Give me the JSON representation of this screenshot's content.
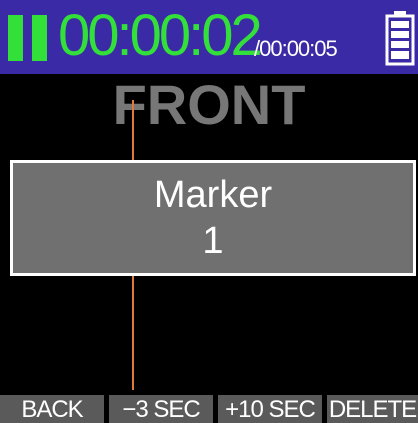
{
  "status_bar": {
    "state_icon": "pause-icon",
    "elapsed_time": "00:00:02",
    "total_time": "/00:00:05",
    "battery_icon": "battery-icon"
  },
  "track": {
    "name": "FRONT"
  },
  "marker_dialog": {
    "title": "Marker",
    "number": "1"
  },
  "softkeys": {
    "back": "BACK",
    "minus3": "−3 SEC",
    "plus10": "+10 SEC",
    "delete": "DELETE"
  },
  "colors": {
    "header_bg": "#3b2aa6",
    "time_green": "#33e03a",
    "playhead": "#e07a3c",
    "dialog_bg": "#707070",
    "softkey_bg": "#5a5a5a"
  }
}
